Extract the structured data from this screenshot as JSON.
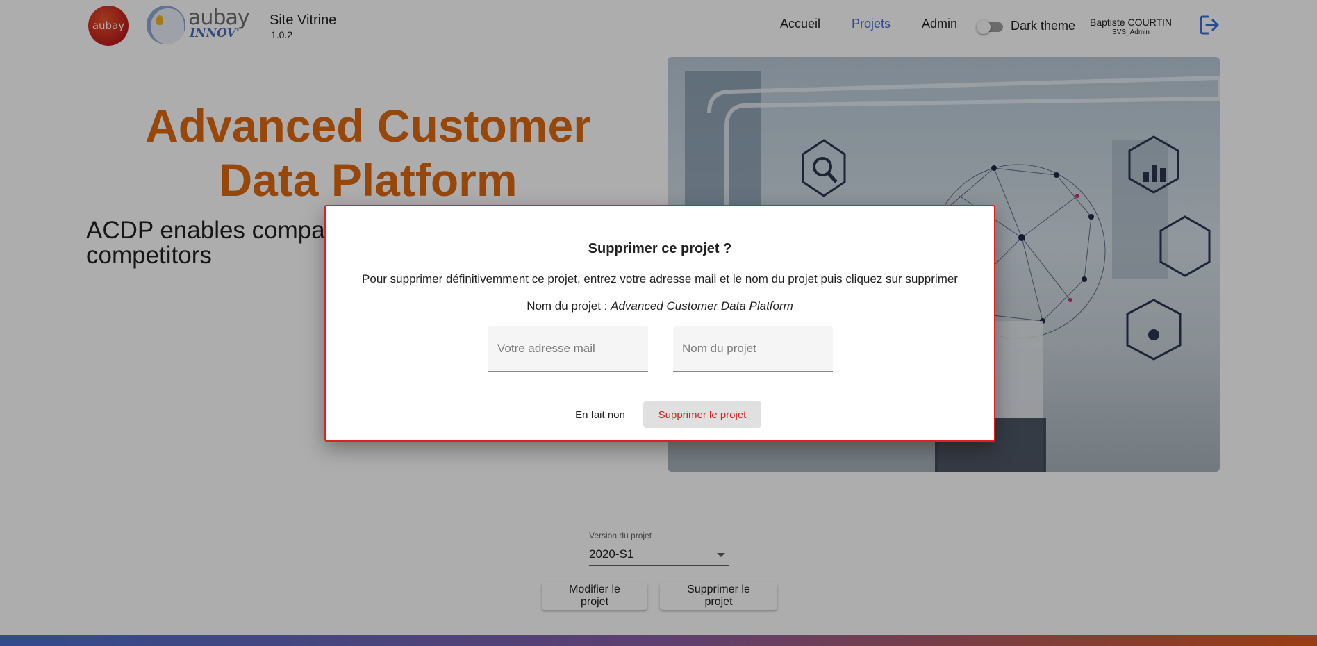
{
  "header": {
    "logo_aubay_text": "aubay",
    "logo_innov_word": "aubay",
    "logo_innov_sub": "INNOV'",
    "site_title": "Site Vitrine",
    "site_version": "1.0.2",
    "nav": [
      {
        "label": "Accueil",
        "active": false
      },
      {
        "label": "Projets",
        "active": true
      },
      {
        "label": "Admin",
        "active": false
      }
    ],
    "dark_theme_label": "Dark theme",
    "dark_theme_on": false,
    "user_name": "Baptiste COURTIN",
    "user_role": "SVS_Admin",
    "logout_icon": "logout-icon"
  },
  "hero": {
    "title": "Advanced Customer Data Platform",
    "description": "ACDP enables compa are perceived and to c competitors"
  },
  "project_controls": {
    "version_label": "Version du projet",
    "version_value": "2020-S1",
    "edit_button": "Modifier le projet",
    "delete_button": "Supprimer le projet"
  },
  "dialog": {
    "title": "Supprimer ce projet ?",
    "text": "Pour supprimer définitivemment ce projet, entrez votre adresse mail et le nom du projet puis cliquez sur supprimer",
    "name_prefix": "Nom du projet : ",
    "name_value": "Advanced Customer Data Platform",
    "email_placeholder": "Votre adresse mail",
    "email_value": "",
    "project_placeholder": "Nom du projet",
    "project_value": "",
    "cancel_label": "En fait non",
    "confirm_label": "Supprimer le projet"
  },
  "colors": {
    "accent_orange": "#e0690f",
    "nav_active": "#3f6fd8",
    "danger_red": "#d32020"
  }
}
